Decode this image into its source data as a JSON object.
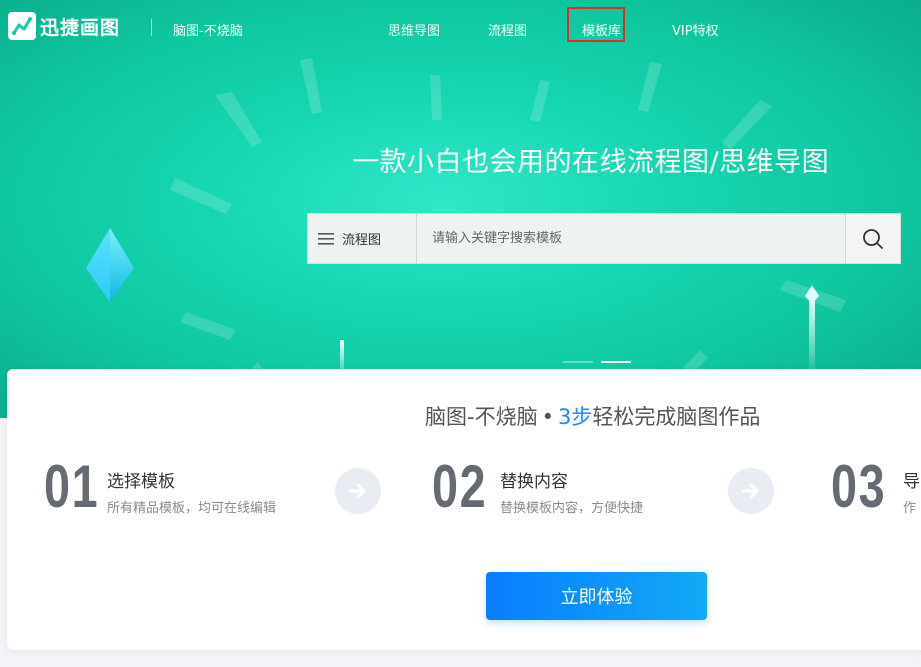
{
  "brand": {
    "name": "迅捷画图",
    "slogan": "脑图-不烧脑"
  },
  "nav": [
    {
      "label": "思维导图"
    },
    {
      "label": "流程图"
    },
    {
      "label": "模板库",
      "active": true
    },
    {
      "label": "VIP特权"
    }
  ],
  "hero": {
    "headline": "一款小白也会用的在线流程图/思维导图"
  },
  "search": {
    "category": "流程图",
    "placeholder": "请输入关键字搜索模板"
  },
  "carousel": {
    "slides": 2,
    "active_index": 1
  },
  "steps_section": {
    "title_prefix": "脑图-不烧脑",
    "title_dot": "•",
    "title_highlight": "3步",
    "title_suffix": "轻松完成脑图作品",
    "steps": [
      {
        "number": "01",
        "title": "选择模板",
        "desc": "所有精品模板，均可在线编辑"
      },
      {
        "number": "02",
        "title": "替换内容",
        "desc": "替换模板内容，方便快捷"
      },
      {
        "number": "03",
        "title": "导",
        "desc": "作"
      }
    ],
    "cta_label": "立即体验"
  },
  "colors": {
    "accent": "#1a8cff",
    "hero": "#16d6b2",
    "highlight_box": "#e62a2a"
  }
}
